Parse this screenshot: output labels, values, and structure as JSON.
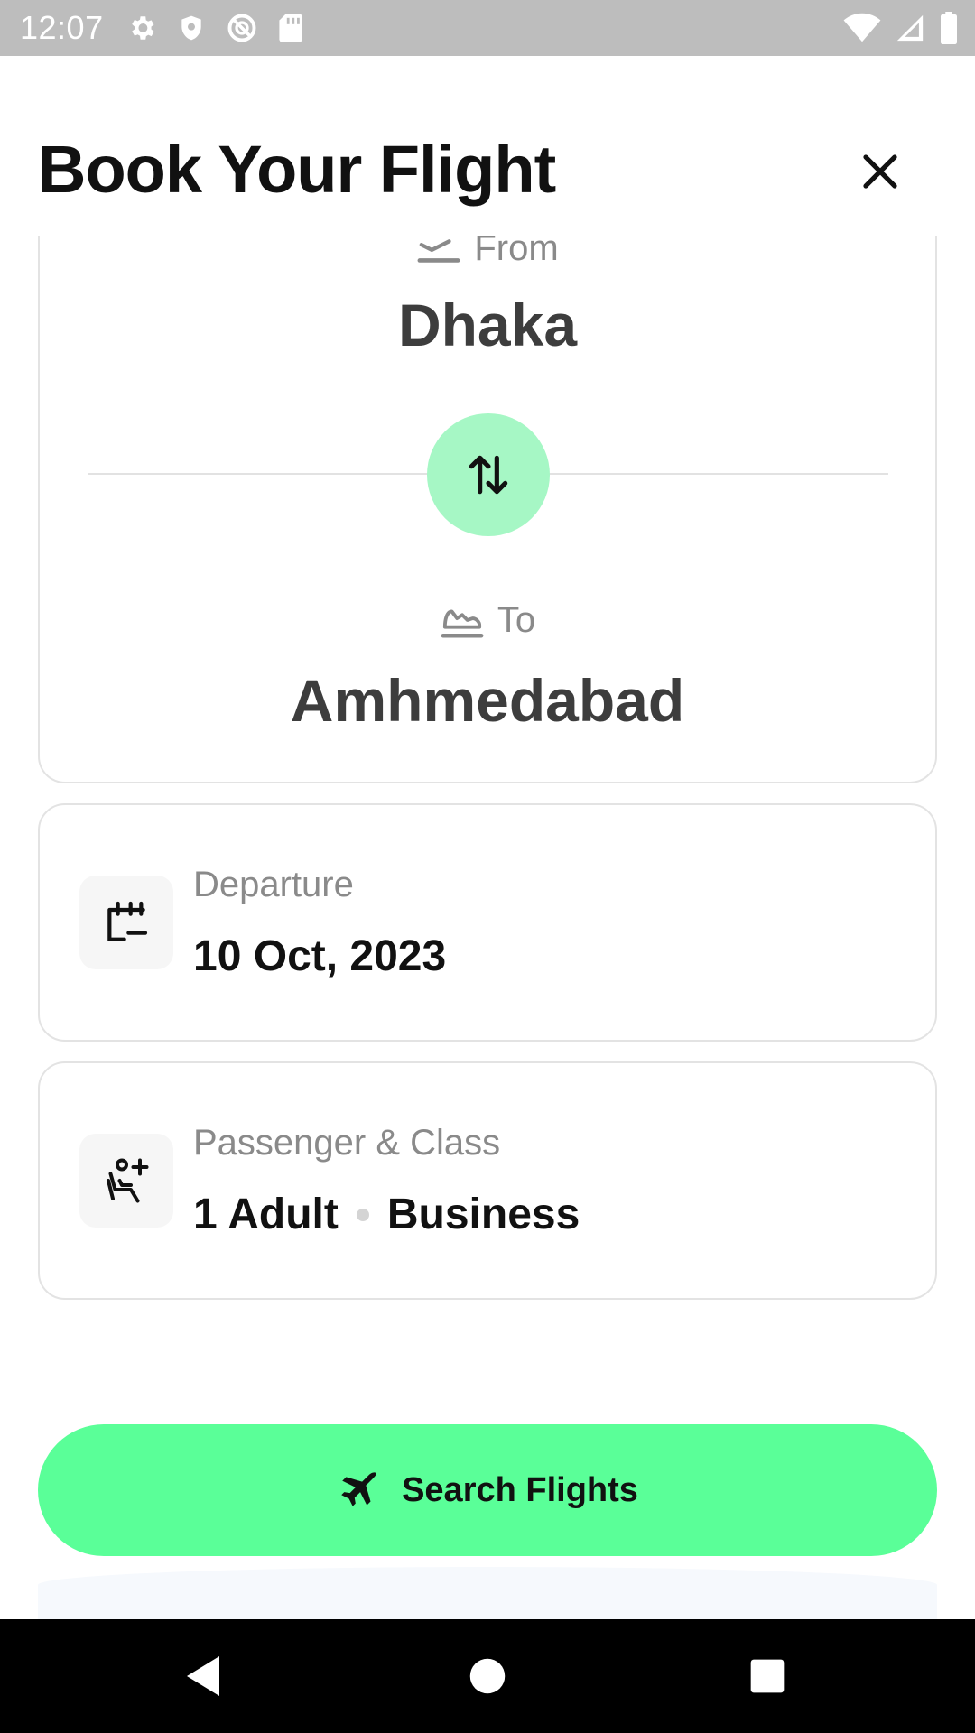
{
  "status_bar": {
    "time": "12:07",
    "left_icons": [
      "settings-icon",
      "shield-icon",
      "data-saver-icon",
      "sd-card-icon"
    ],
    "right_icons": [
      "wifi-icon",
      "signal-icon",
      "battery-icon"
    ]
  },
  "header": {
    "title": "Book Your Flight",
    "close_icon": "close-icon"
  },
  "route": {
    "from_label": "From",
    "from_city": "Dhaka",
    "to_label": "To",
    "to_city": "Amhmedabad",
    "swap_icon": "swap-vertical-icon"
  },
  "departure": {
    "label": "Departure",
    "value": "10 Oct, 2023",
    "icon": "calendar-icon"
  },
  "passenger": {
    "label": "Passenger & Class",
    "passengers": "1 Adult",
    "class": "Business",
    "icon": "seat-add-icon"
  },
  "search": {
    "label": "Search Flights",
    "icon": "airplane-icon"
  },
  "colors": {
    "accent": "#5aff98",
    "swap_bg": "#a6f7c5",
    "status_bar": "#bdbdbd"
  }
}
